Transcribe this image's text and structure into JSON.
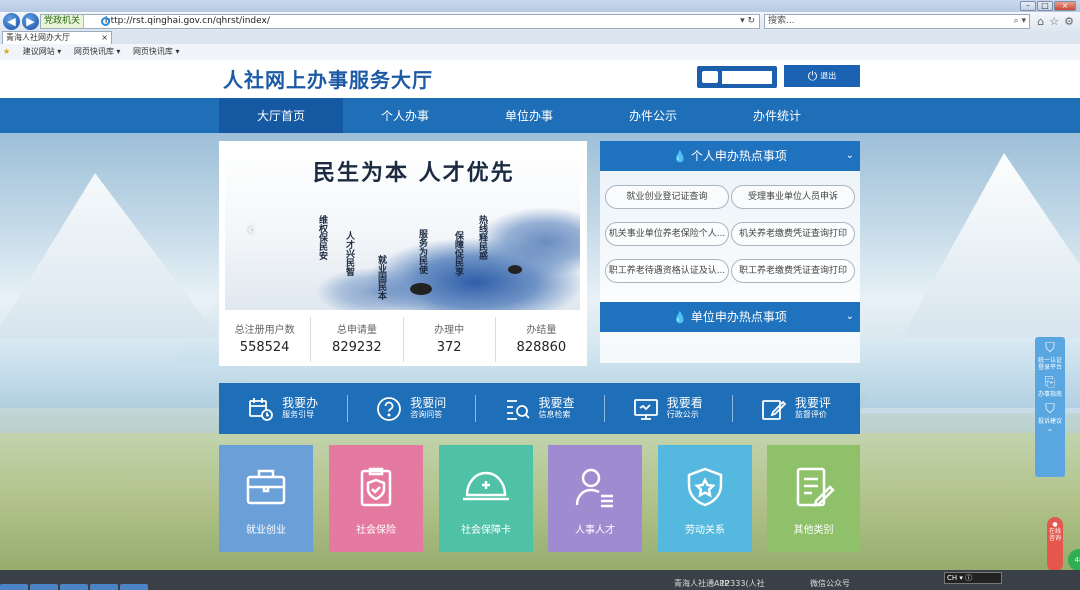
{
  "browser": {
    "zone_label": "党政机关",
    "url": "http://rst.qinghai.gov.cn/qhrst/index/",
    "search_placeholder": "搜索...",
    "tab_title": "青海人社网办大厅",
    "favorites": [
      "建议网站 ▾",
      "网页快讯库 ▾",
      "网页快讯库 ▾"
    ]
  },
  "header": {
    "logo": "人社网上办事服务大厅",
    "logout_label": "退出"
  },
  "nav": {
    "items": [
      "大厅首页",
      "个人办事",
      "单位办事",
      "办件公示",
      "办件统计"
    ]
  },
  "banner": {
    "slogan": "民生为本  人才优先",
    "verticals": [
      "维权保民安",
      "人才兴民智",
      "就业固民本",
      "服务为民使",
      "保障促民享",
      "热线释民惑"
    ]
  },
  "stats": [
    {
      "label": "总注册用户数",
      "value": "558524"
    },
    {
      "label": "总申请量",
      "value": "829232"
    },
    {
      "label": "办理中",
      "value": "372"
    },
    {
      "label": "办结量",
      "value": "828860"
    }
  ],
  "hot_personal": {
    "title": "个人申办热点事项",
    "items": [
      "就业创业登记证查询",
      "受理事业单位人员申诉",
      "机关事业单位养老保险个人...",
      "机关养老缴费凭证查询打印",
      "职工养老待遇资格认证及认...",
      "职工养老缴费凭证查询打印"
    ]
  },
  "hot_unit": {
    "title": "单位申办热点事项"
  },
  "quick": [
    {
      "title": "我要办",
      "sub": "服务引导"
    },
    {
      "title": "我要问",
      "sub": "咨询问答"
    },
    {
      "title": "我要查",
      "sub": "信息检索"
    },
    {
      "title": "我要看",
      "sub": "行政公示"
    },
    {
      "title": "我要评",
      "sub": "监督评价"
    }
  ],
  "tiles": [
    {
      "label": "就业创业",
      "color": "#6a9fd8"
    },
    {
      "label": "社会保险",
      "color": "#e57aa0"
    },
    {
      "label": "社会保障卡",
      "color": "#4fc1a6"
    },
    {
      "label": "人事人才",
      "color": "#9f8bd0"
    },
    {
      "label": "劳动关系",
      "color": "#55b9df"
    },
    {
      "label": "其他类别",
      "color": "#8fc06a"
    }
  ],
  "side": {
    "items": [
      "统一认证 登录平台",
      "办事指南",
      "投诉建议"
    ],
    "online": "在线咨询",
    "ball": "48"
  },
  "footer": {
    "app": "青海人社通APP",
    "hotline": "12333(人社",
    "wechat": "微信公众号",
    "tray": "CH"
  }
}
